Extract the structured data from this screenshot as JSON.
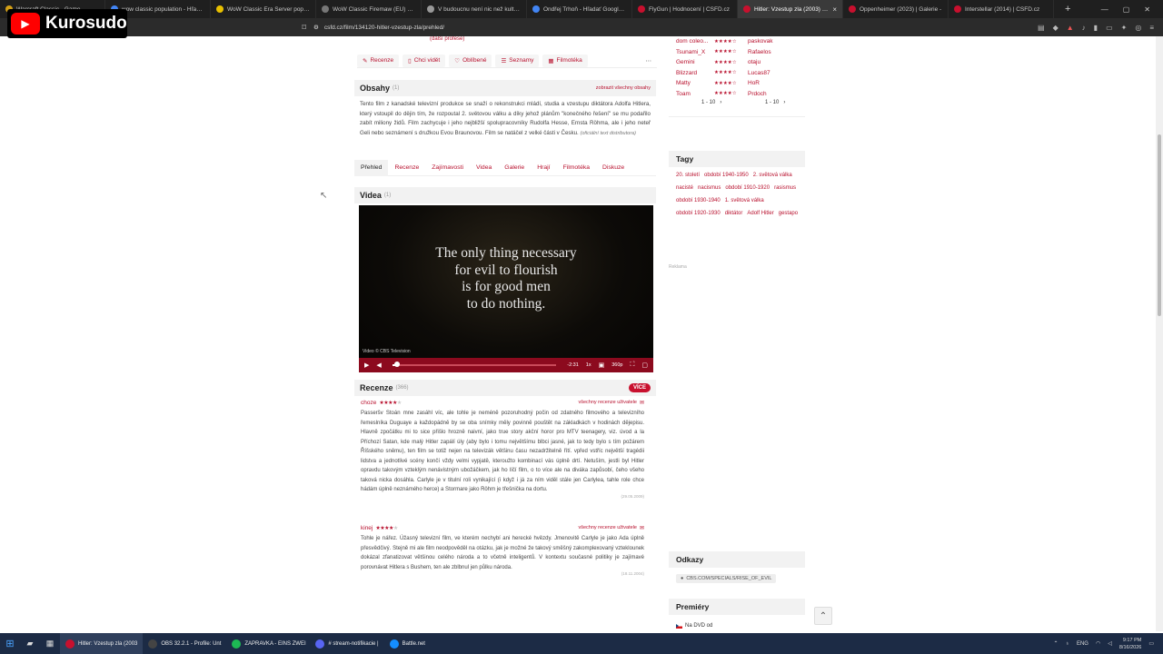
{
  "browser": {
    "tabs": [
      {
        "title": "Warcraft Classic - Game",
        "color": "#d4a017"
      },
      {
        "title": "wow classic population - Hľadať",
        "color": "#4285f4"
      },
      {
        "title": "WoW Classic Era Server populatio",
        "color": "#e8c000"
      },
      {
        "title": "WoW Classic Firemaw (EU) Populati",
        "color": "#777777"
      },
      {
        "title": "V budoucnu není nic než kulturní",
        "color": "#999999"
      },
      {
        "title": "Ondřej Trhoň - Hľadať Googlom",
        "color": "#4285f4"
      },
      {
        "title": "FlyGun | Hodnocení | ČSFD.cz",
        "color": "#c8102e"
      },
      {
        "title": "Hitler: Vzestup zla (2003) | ČSFD",
        "color": "#c8102e"
      },
      {
        "title": "Oppenheimer (2023) | Galerie - ",
        "color": "#c8102e"
      },
      {
        "title": "Interstellar (2014) | ČSFD.cz",
        "color": "#c8102e"
      }
    ],
    "url": "csfd.cz/film/134120-hitler-vzestup-zla/prehled/"
  },
  "overlay": {
    "channel": "Kurosudo"
  },
  "film": {
    "creator_more": "(další profese)",
    "actions": [
      {
        "icon": "✎",
        "label": "Recenze"
      },
      {
        "icon": "▯",
        "label": "Chci vidět"
      },
      {
        "icon": "♡",
        "label": "Oblíbené"
      },
      {
        "icon": "☰",
        "label": "Seznamy"
      },
      {
        "icon": "▦",
        "label": "Filmotéka"
      }
    ],
    "more_icon": "⋯",
    "obsahy": {
      "title": "Obsahy",
      "count": "(1)",
      "link": "zobrazit všechny obsahy",
      "text": "Tento film z kanadské televizní produkce se snaží o rekonstrukci mládí, studia a vzestupu diktátora Adolfa Hitlera, který vstoupil do dějin tím, že rozpoutal 2. světovou válku a díky jehož plánům \"konečného řešení\" se mu podařilo zabít miliony židů. Film zachycuje i jeho nejbližší spolupracovníky Rudolfa Hesse, Ernsta Röhma, ale i jeho neteř Geli nebo seznámení s družkou Evou Braunovou. Film se natáčel z velké části v Česku.",
      "source": "(oficiální text distributora)"
    },
    "subnav": [
      "Přehled",
      "Recenze",
      "Zajímavosti",
      "Videa",
      "Galerie",
      "Hrají",
      "Filmotéka",
      "Diskuze"
    ],
    "videa": {
      "title": "Videa",
      "count": "(1)",
      "quote": [
        "The only thing necessary",
        "for evil to flourish",
        "is for good men",
        "to do nothing."
      ],
      "credit": "Video © CBS Television",
      "time": "-2:31",
      "speed": "1x",
      "quality": "360p",
      "progress": 0.03
    },
    "recenze": {
      "title": "Recenze",
      "count": "(366)",
      "more": "VÍCE",
      "all_label": "všechny recenze uživatele",
      "items": [
        {
          "user": "choze",
          "stars": 4,
          "text": "Passeršv Stoán mne zasáhl víc, ale tohle je neméně pozoruhodný počin od zdatného filmového a televizního řemeslníka Duguaye a každopádně by se oba snímky měly povinně pouštět na základkách v hodinách dějepisu. Hlavně zpočátku mi to sice přišlo hrozně naivní, jako true story akční horor pro MTV teenagery, viz. úvod a la Příchozí Satan, kde malý Hitler zapálí úly (aby bylo i tomu největšímu blbci jasné, jak to tedy bylo s tím požárem Říšského sněmu), ten film se totiž nejen na televizák většinu času nezadržitelně řítí. vpřed vstříc největší tragédii lidstva a jednotlivé scény končí vždy velmi vypjatě, kteroužto kombinací vás úplně drtí. Netuším, jestli byl Hitler opravdu takovým vzteklým nenávistným ubožáčkem, jak ho líčí film, o to více ale na diváka zapůsobí, čeho všeho taková nicka dosáhla. Carlyle je v titulní roli vynikající (i když i já za ním viděl stále jen Carlylea, tahle role chce hádám úplně neznámého herce) a Stormare jako Röhm je třešnička na dortu.",
          "date": "(29.05.2009)"
        },
        {
          "user": "kinej",
          "stars": 4,
          "text": "Tohle je nářez. Úžasný televizní film, ve kterém nechybí ani herecké hvězdy. Jmenovitě Carlyle je jako Ada úplně přesvědčivý. Stejně mi ale film neodpověděl na otázku, jak je možné že takový směšný zakomplexovaný vzteklounek dokázal zfanatizovat většinou celého národa a to včetně inteligentů. V kontextu současné politiky je zajímavé porovnávat Hitlera s Bushem, ten ale zblbnul jen půlku národa.",
          "date": "(18.11.2004)"
        }
      ]
    }
  },
  "sidebar": {
    "ratings": [
      {
        "left": "dom coleo...",
        "stars": 4,
        "right": "paskovak"
      },
      {
        "left": "Tsunami_X",
        "stars": 4,
        "right": "Rafaelos"
      },
      {
        "left": "Gemini",
        "stars": 4,
        "right": "otaju"
      },
      {
        "left": "Blizzard",
        "stars": 4,
        "right": "Lucas87"
      },
      {
        "left": "Matty",
        "stars": 4,
        "right": "HoR"
      },
      {
        "left": "Toam",
        "stars": 4,
        "right": "Prdoch"
      }
    ],
    "pager_left": "1 - 10",
    "pager_right": "1 - 10",
    "tagy_title": "Tagy",
    "tags": [
      "20. století",
      "období 1940-1950",
      "2. světová válka",
      "nacisté",
      "nacismus",
      "období 1910-1920",
      "rasismus",
      "období 1930-1940",
      "1. světová válka",
      "období 1920-1930",
      "diktátor",
      "Adolf Hitler",
      "gestapo"
    ],
    "reklama": "Reklama",
    "odkazy_title": "Odkazy",
    "odkaz_link": "CBS.COM/SPECIALS/RISE_OF_EVIL",
    "premiery_title": "Premiéry",
    "premiera": "Na DVD od"
  },
  "taskbar": {
    "apps": [
      {
        "label": "Hitler: Vzestup zla (2003",
        "color": "#c8102e",
        "active": true
      },
      {
        "label": "OBS 32.2.1 - Profile: Unt",
        "color": "#444444",
        "active": false
      },
      {
        "label": "ZAPRAVKA - EINS ZWEI",
        "color": "#1db954",
        "active": false
      },
      {
        "label": "# stream-notifikacie |",
        "color": "#5865f2",
        "active": false
      },
      {
        "label": "Battle.net",
        "color": "#148eff",
        "active": false
      }
    ],
    "lang": "ENG",
    "time": "9:17 PM",
    "date": "8/16/2026"
  }
}
